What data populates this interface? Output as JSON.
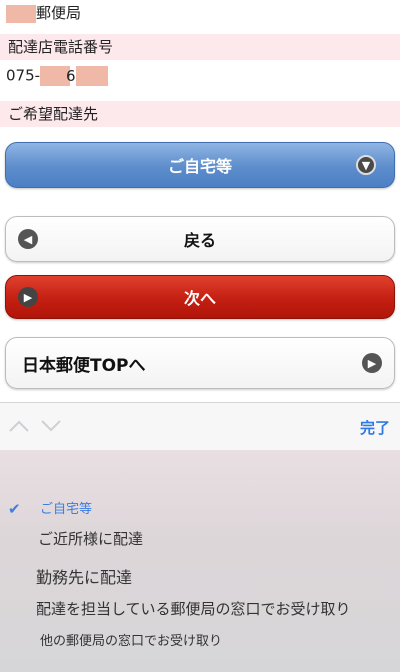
{
  "top": {
    "office_suffix": "郵便局",
    "phone_label": "配達店電話番号",
    "phone_prefix": "075-",
    "phone_mid_char": "6",
    "destination_label": "ご希望配達先"
  },
  "select": {
    "value": "ご自宅等",
    "icon": "chevron-down-icon"
  },
  "buttons": {
    "back": "戻る",
    "next": "次へ",
    "top": "日本郵便TOPへ"
  },
  "toolbar": {
    "done": "完了"
  },
  "picker": {
    "options": [
      "ご自宅等",
      "ご近所様に配達",
      "勤務先に配達",
      "配達を担当している郵便局の窓口でお受け取り",
      "他の郵便局の窓口でお受け取り"
    ],
    "selected_index": 0
  },
  "colors": {
    "blue_button": "#5d8dcc",
    "red_button": "#c41f12",
    "done_link": "#2f7ae5",
    "pink_band": "#fde9ec"
  }
}
